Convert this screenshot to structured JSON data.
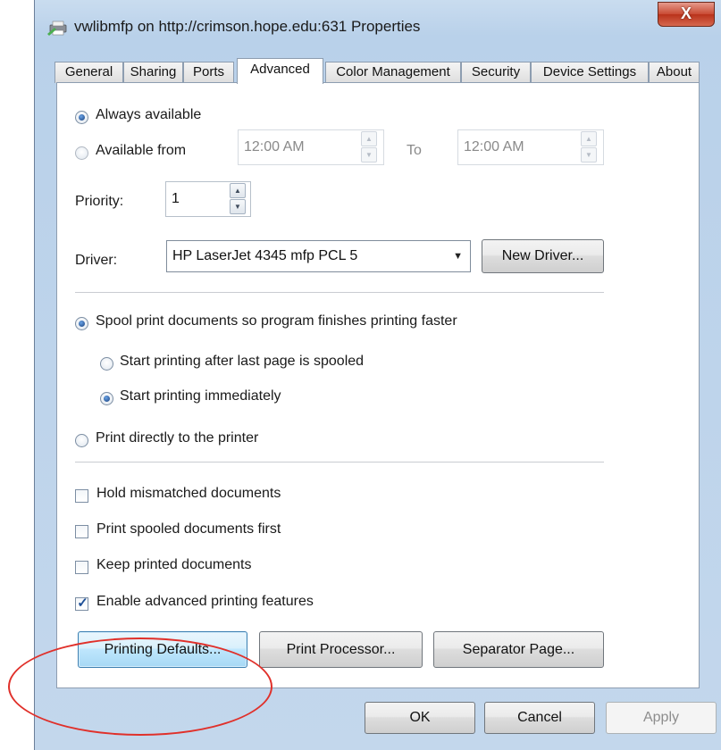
{
  "window": {
    "title": "vwlibmfp on http://crimson.hope.edu:631 Properties",
    "close_label": "X"
  },
  "tabs": [
    {
      "label": "General"
    },
    {
      "label": "Sharing"
    },
    {
      "label": "Ports"
    },
    {
      "label": "Advanced",
      "active": true
    },
    {
      "label": "Color Management"
    },
    {
      "label": "Security"
    },
    {
      "label": "Device Settings"
    },
    {
      "label": "About"
    }
  ],
  "availability": {
    "always_label": "Always available",
    "from_label": "Available from",
    "from_time": "12:00 AM",
    "to_label": "To",
    "to_time": "12:00 AM",
    "selected": "always"
  },
  "priority": {
    "label": "Priority:",
    "value": "1"
  },
  "driver": {
    "label": "Driver:",
    "value": "HP LaserJet 4345 mfp PCL 5",
    "new_driver_label": "New Driver..."
  },
  "spooling": {
    "spool_label": "Spool print documents so program finishes printing faster",
    "after_last_label": "Start printing after last page is spooled",
    "immediately_label": "Start printing immediately",
    "direct_label": "Print directly to the printer",
    "selected": "spool",
    "sub_selected": "immediately"
  },
  "options": [
    {
      "label": "Hold mismatched documents",
      "checked": false
    },
    {
      "label": "Print spooled documents first",
      "checked": false
    },
    {
      "label": "Keep printed documents",
      "checked": false
    },
    {
      "label": "Enable advanced printing features",
      "checked": true
    }
  ],
  "panel_buttons": {
    "printing_defaults": "Printing Defaults...",
    "print_processor": "Print Processor...",
    "separator_page": "Separator Page..."
  },
  "dialog_buttons": {
    "ok": "OK",
    "cancel": "Cancel",
    "apply": "Apply"
  },
  "colors": {
    "annotation_circle": "#e0302a",
    "focus_button": "#bee6fd",
    "close_button": "#c94a33"
  }
}
